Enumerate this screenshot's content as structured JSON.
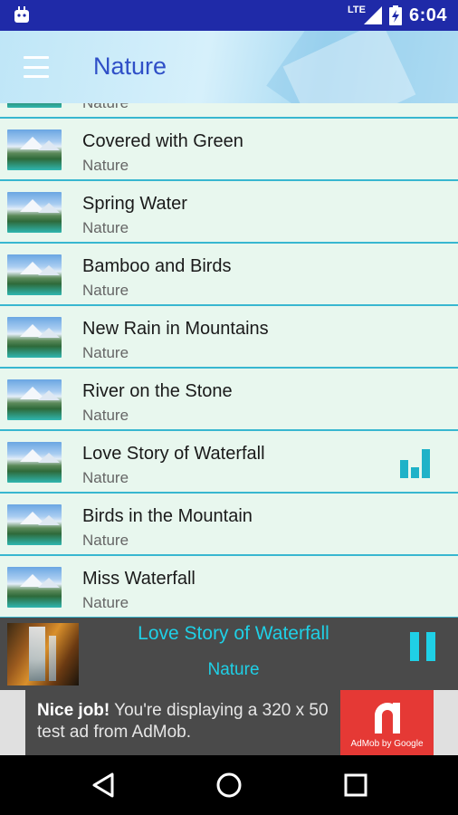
{
  "status_bar": {
    "network": "LTE",
    "time": "6:04",
    "icons": [
      "android-icon",
      "signal-icon",
      "battery-icon"
    ]
  },
  "app_bar": {
    "title": "Nature",
    "menu_icon": "hamburger-menu-icon"
  },
  "tracks": [
    {
      "title": "",
      "subtitle": "Nature"
    },
    {
      "title": "Covered with Green",
      "subtitle": "Nature"
    },
    {
      "title": "Spring Water",
      "subtitle": "Nature"
    },
    {
      "title": "Bamboo and Birds",
      "subtitle": "Nature"
    },
    {
      "title": "New Rain in Mountains",
      "subtitle": "Nature"
    },
    {
      "title": "River on the Stone",
      "subtitle": "Nature"
    },
    {
      "title": "Love Story of Waterfall",
      "subtitle": "Nature",
      "playing": true
    },
    {
      "title": "Birds in the Mountain",
      "subtitle": "Nature"
    },
    {
      "title": "Miss Waterfall",
      "subtitle": "Nature"
    }
  ],
  "now_playing": {
    "title": "Love Story of Waterfall",
    "subtitle": "Nature",
    "control_icon": "pause-icon"
  },
  "ad": {
    "bold": "Nice job!",
    "text": " You're displaying a 320 x 50 test ad from AdMob.",
    "logo_text": "AdMob by Google"
  },
  "nav": {
    "back": "back-icon",
    "home": "home-icon",
    "recents": "recents-icon"
  },
  "colors": {
    "status_bar": "#1f2aa8",
    "accent": "#1fd0e6",
    "list_background": "#e8f7ee",
    "divider": "#38b7d0",
    "title": "#2f4fc7"
  }
}
